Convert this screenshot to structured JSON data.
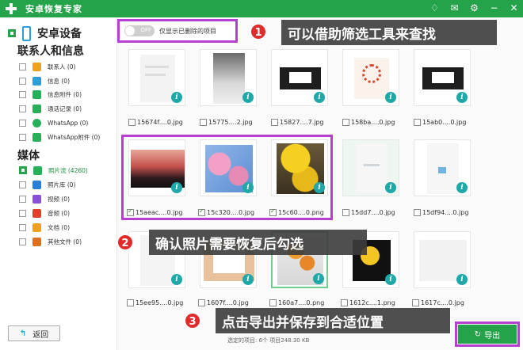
{
  "window": {
    "title": "安卓恢复专家"
  },
  "sidebar": {
    "device": "安卓设备",
    "contacts_section": "联系人和信息",
    "contacts_items": [
      {
        "label": "联系人 (0)",
        "icon": "contacts-icon",
        "color": "#f0a020"
      },
      {
        "label": "信息 (0)",
        "icon": "message-icon",
        "color": "#2a9fd8"
      },
      {
        "label": "信息附件 (0)",
        "icon": "attachment-icon",
        "color": "#26b05a"
      },
      {
        "label": "通话记录 (0)",
        "icon": "call-log-icon",
        "color": "#26b05a"
      },
      {
        "label": "WhatsApp (0)",
        "icon": "whatsapp-icon",
        "color": "#26b05a"
      },
      {
        "label": "WhatsApp附件 (0)",
        "icon": "whatsapp-attachment-icon",
        "color": "#26b05a"
      }
    ],
    "media_section": "媒体",
    "media_items": [
      {
        "label": "照片流 (4260)",
        "icon": "photo-stream-icon",
        "color": "#26b05a",
        "checked": true
      },
      {
        "label": "照片库 (0)",
        "icon": "photo-library-icon",
        "color": "#2a7fd8",
        "checked": false
      },
      {
        "label": "视频 (0)",
        "icon": "video-icon",
        "color": "#8a4fd8",
        "checked": false
      },
      {
        "label": "音频 (0)",
        "icon": "audio-icon",
        "color": "#e0402a",
        "checked": false
      },
      {
        "label": "文档 (0)",
        "icon": "document-icon",
        "color": "#f0a020",
        "checked": false
      },
      {
        "label": "其他文件 (0)",
        "icon": "other-files-icon",
        "color": "#e07020",
        "checked": false
      }
    ],
    "back_label": "返回"
  },
  "toolbar": {
    "toggle_text": "OFF",
    "filter_label": "仅显示已删除的项目"
  },
  "files": [
    {
      "name": "15674f....0.jpg",
      "checked": false
    },
    {
      "name": "15775....2.jpg",
      "checked": false
    },
    {
      "name": "15827....7.jpg",
      "checked": false
    },
    {
      "name": "158ba....0.jpg",
      "checked": false
    },
    {
      "name": "15ab0....0.jpg",
      "checked": false
    },
    {
      "name": "15aeac....0.jpg",
      "checked": true
    },
    {
      "name": "15c320....0.jpg",
      "checked": true
    },
    {
      "name": "15c60....0.png",
      "checked": true
    },
    {
      "name": "15dd7....0.jpg",
      "checked": false
    },
    {
      "name": "15df94....0.jpg",
      "checked": false
    },
    {
      "name": "15ee95....0.jpg",
      "checked": false
    },
    {
      "name": "1607f....0.jpg",
      "checked": false
    },
    {
      "name": "160a7....0.png",
      "checked": false
    },
    {
      "name": "1612c....1.png",
      "checked": false
    },
    {
      "name": "1617c....0.jpg",
      "checked": false
    }
  ],
  "callouts": [
    {
      "number": "1",
      "text": "可以借助筛选工具来查找"
    },
    {
      "number": "2",
      "text": "确认照片需要恢复后勾选"
    },
    {
      "number": "3",
      "text": "点击导出并保存到合适位置"
    }
  ],
  "status": "选定的项目: 6个 项目248.30 KB",
  "export_label": "导出"
}
